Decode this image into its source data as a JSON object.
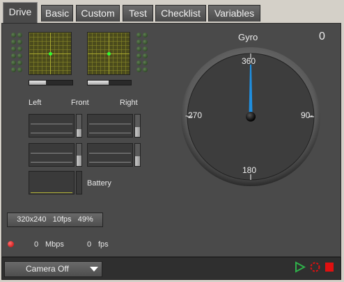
{
  "tabs": [
    {
      "label": "Drive",
      "active": true
    },
    {
      "label": "Basic"
    },
    {
      "label": "Custom"
    },
    {
      "label": "Test"
    },
    {
      "label": "Checklist"
    },
    {
      "label": "Variables"
    }
  ],
  "drive": {
    "labels": {
      "left": "Left",
      "front": "Front",
      "right": "Right",
      "battery": "Battery"
    },
    "left_joystick_level": 0.38,
    "right_joystick_level": 0.48,
    "vbar_levels": [
      0.35,
      0.45,
      0.48,
      0.45
    ]
  },
  "gyro": {
    "title": "Gyro",
    "value": "0",
    "ticks": {
      "top": "360",
      "bottom": "180",
      "left": "-270",
      "right": "90-"
    }
  },
  "camera": {
    "resolution": "320x240",
    "fps_setting": "10fps",
    "quality": "49%",
    "mbps_value": "0",
    "mbps_unit": "Mbps",
    "fps_value": "0",
    "fps_unit": "fps",
    "dropdown": "Camera Off"
  },
  "colors": {
    "accent": "#1f8fe0",
    "play": "#2fb14a",
    "stop": "#e01010",
    "led_red": "#e01010"
  }
}
